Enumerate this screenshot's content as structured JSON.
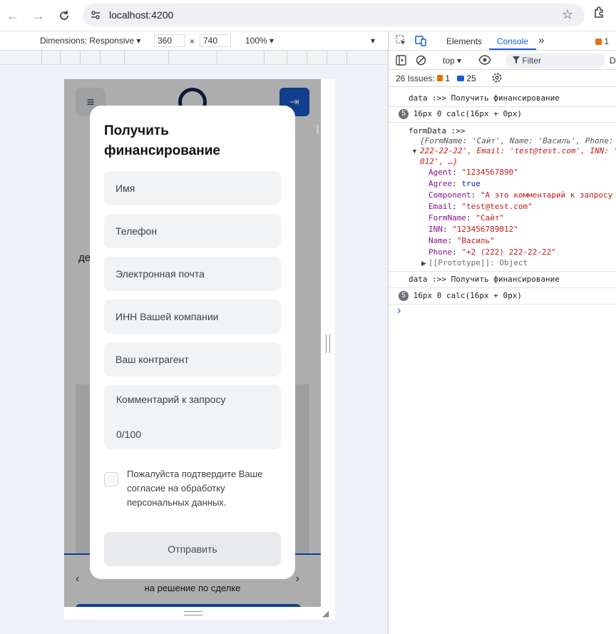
{
  "browser": {
    "url": "localhost:4200"
  },
  "device_toolbar": {
    "dimensions_label": "Dimensions: Responsive",
    "width": "360",
    "times": "×",
    "height": "740",
    "zoom": "100%"
  },
  "page": {
    "bg_text_left": "де",
    "bg_text_right": "!",
    "bg_bottom_text": "на решение по сделке"
  },
  "modal": {
    "title": "Получить финансирование",
    "fields": [
      {
        "placeholder": "Имя"
      },
      {
        "placeholder": "Телефон"
      },
      {
        "placeholder": "Электронная почта"
      },
      {
        "placeholder": "ИНН Вашей компании"
      },
      {
        "placeholder": "Ваш контрагент"
      }
    ],
    "comment_placeholder": "Комментарий к запросу",
    "comment_counter": "0/100",
    "consent_text": "Пожалуйста подтвердите Ваше согласие на обработку персональных данных.",
    "submit_label": "Отправить"
  },
  "devtools": {
    "tabs": {
      "elements": "Elements",
      "console": "Console",
      "more": "»",
      "errors_count": "1"
    },
    "toolbar": {
      "context": "top",
      "filter_placeholder": "Filter",
      "default_levels": "D"
    },
    "issues": {
      "label": "26 Issues:",
      "warnings": "1",
      "info": "25"
    },
    "console": {
      "log1": "data :>>  Получить финансирование",
      "repeat_count": "5",
      "log2": "16px 0 calc(16px + 0px)",
      "formdata_label": "formData :>>",
      "preview_line1": "{FormName: 'Сайт', Name: 'Василь', Phone: '",
      "preview_line2": "222-22-22', Email: 'test@test.com', INN: '",
      "preview_line3": "012', …}",
      "props": [
        {
          "key": "Agent",
          "value": "\"1234567890\"",
          "type": "string"
        },
        {
          "key": "Agree",
          "value": "true",
          "type": "bool"
        },
        {
          "key": "Component",
          "value": "\"А это комментарий к запросу",
          "type": "string"
        },
        {
          "key": "Email",
          "value": "\"test@test.com\"",
          "type": "string"
        },
        {
          "key": "FormName",
          "value": "\"Сайт\"",
          "type": "string"
        },
        {
          "key": "INN",
          "value": "\"123456789012\"",
          "type": "string"
        },
        {
          "key": "Name",
          "value": "\"Василь\"",
          "type": "string"
        },
        {
          "key": "Phone",
          "value": "\"+2 (222) 222-22-22\"",
          "type": "string"
        }
      ],
      "prototype": "[[Prototype]]: Object",
      "log3": "data :>>  Получить финансирование",
      "repeat_count2": "5",
      "log4": "16px 0 calc(16px + 0px)",
      "prompt": "›"
    }
  }
}
